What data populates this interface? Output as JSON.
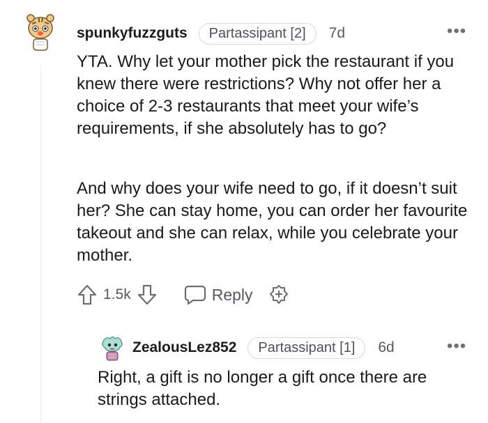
{
  "comment": {
    "username": "spunkyfuzzguts",
    "flair": "Partassipant [2]",
    "age": "7d",
    "paragraphs": [
      "YTA. Why let your mother pick the restaurant if you knew there were restrictions? Why not offer her a choice of 2-3 restaurants that meet your wife’s requirements, if she absolutely has to go?",
      "And why does your wife need to go, if it doesn’t suit her? She can stay home, you can order her favourite takeout and she can relax, while you celebrate your mother."
    ],
    "votes": "1.5k",
    "reply_label": "Reply",
    "more_icon": "more-options-icon"
  },
  "reply": {
    "username": "ZealousLez852",
    "flair": "Partassipant [1]",
    "age": "6d",
    "text": "Right, a gift is no longer a gift once there are strings attached.",
    "more_icon": "more-options-icon"
  },
  "colors": {
    "text": "#1a1a1b",
    "meta": "#55595d",
    "flair_border": "#d7dadc",
    "thread_line": "#edeff1"
  }
}
